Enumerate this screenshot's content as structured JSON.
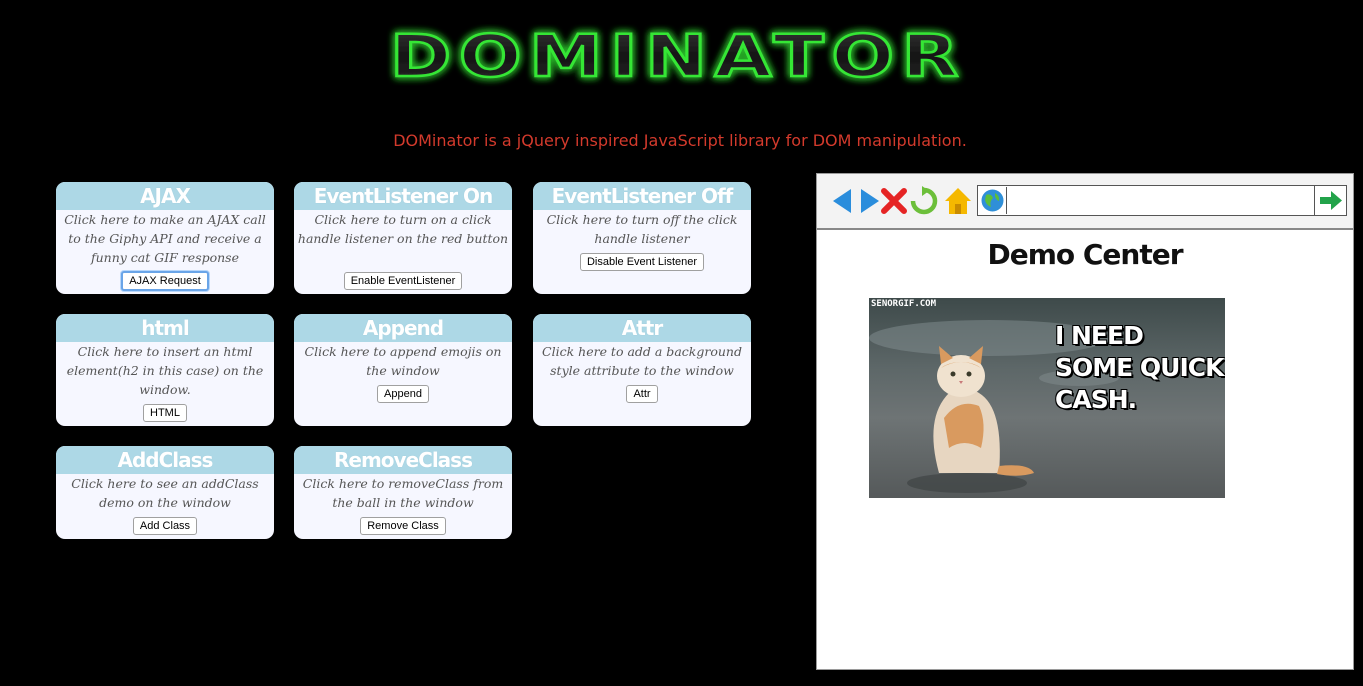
{
  "header": {
    "logo_text": "DOMINATOR",
    "subtitle": "DOMinator is a jQuery inspired JavaScript library for DOM manipulation."
  },
  "cards": [
    {
      "title": "AJAX",
      "description": "Click here to make an AJAX call to the Giphy API and receive a funny cat GIF response",
      "button": "AJAX Request"
    },
    {
      "title": "EventListener On",
      "description": "Click here to turn on a click handle listener on the red button",
      "button": "Enable EventListener"
    },
    {
      "title": "EventListener Off",
      "description": "Click here to turn off the click handle listener",
      "button": "Disable Event Listener"
    },
    {
      "title": "html",
      "description": "Click here to insert an html element(h2 in this case) on the window.",
      "button": "HTML"
    },
    {
      "title": "Append",
      "description": "Click here to append emojis on the window",
      "button": "Append"
    },
    {
      "title": "Attr",
      "description": "Click here to add a background style attribute to the window",
      "button": "Attr"
    },
    {
      "title": "AddClass",
      "description": "Click here to see an addClass demo on the window",
      "button": "Add Class"
    },
    {
      "title": "RemoveClass",
      "description": "Click here to removeClass from the ball in the window",
      "button": "Remove Class"
    }
  ],
  "demo": {
    "title": "Demo Center",
    "gif_watermark": "SENORGIF.COM",
    "gif_caption": "I NEED SOME QUICK CASH."
  },
  "icons": {
    "back": "back-arrow-icon",
    "forward": "forward-arrow-icon",
    "stop": "stop-x-icon",
    "refresh": "refresh-icon",
    "home": "home-icon",
    "globe": "globe-icon",
    "go": "go-arrow-icon"
  },
  "colors": {
    "background": "#000000",
    "subtitle": "#d33a2c",
    "card_header": "#add8e6",
    "card_body": "#f6f7ff",
    "logo_glow": "#33ff33"
  }
}
